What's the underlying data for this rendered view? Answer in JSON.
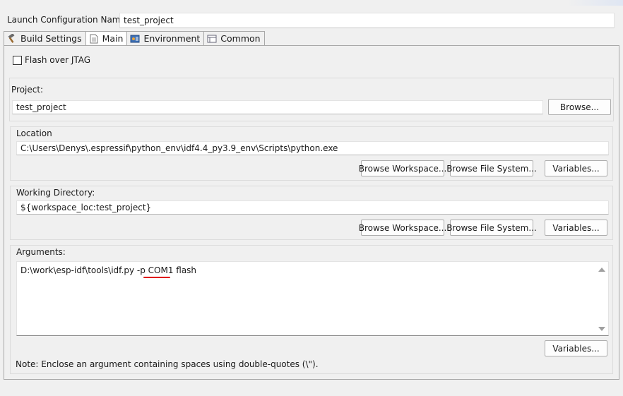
{
  "launch_config": {
    "name_label": "Launch Configuration Name:",
    "name_value": "test_project"
  },
  "tabs": [
    {
      "label": "Build Settings",
      "icon": "hammer-icon",
      "active": false
    },
    {
      "label": "Main",
      "icon": "document-icon",
      "active": true
    },
    {
      "label": "Environment",
      "icon": "environment-icon",
      "active": false
    },
    {
      "label": "Common",
      "icon": "common-icon",
      "active": false
    }
  ],
  "main": {
    "flash_jtag": {
      "label": "Flash over JTAG",
      "checked": false
    },
    "project": {
      "label": "Project:",
      "value": "test_project",
      "browse_label": "Browse..."
    },
    "location": {
      "label": "Location",
      "value": "C:\\Users\\Denys\\.espressif\\python_env\\idf4.4_py3.9_env\\Scripts\\python.exe",
      "browse_workspace_label": "Browse Workspace...",
      "browse_filesystem_label": "Browse File System...",
      "variables_label": "Variables..."
    },
    "working_directory": {
      "label": "Working Directory:",
      "value": "${workspace_loc:test_project}",
      "browse_workspace_label": "Browse Workspace...",
      "browse_filesystem_label": "Browse File System...",
      "variables_label": "Variables..."
    },
    "arguments": {
      "label": "Arguments:",
      "value": "D:\\work\\esp-idf\\tools\\idf.py -p COM1 flash",
      "variables_label": "Variables...",
      "note": "Note: Enclose an argument containing spaces using double-quotes (\\\")."
    }
  },
  "colors": {
    "background": "#f0f0f0",
    "annotation_underline": "#e01010"
  }
}
